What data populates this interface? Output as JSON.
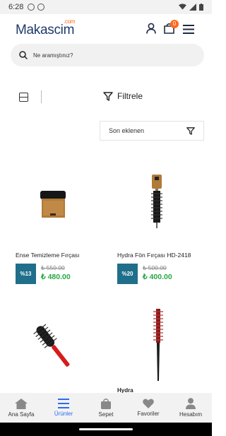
{
  "status_bar": {
    "time": "6:28"
  },
  "header": {
    "logo": "Makascim",
    "logo_suffix": ".com",
    "cart_count": "0"
  },
  "search": {
    "placeholder": "Ne aramıştınız?"
  },
  "toolbar": {
    "filter_label": "Filtrele"
  },
  "sort": {
    "selected": "Son eklenen"
  },
  "products": [
    {
      "name": "Ense Temizleme Fırçası",
      "discount": "%13",
      "old_price": "₺ 550.00",
      "new_price": "₺ 480.00"
    },
    {
      "name": "Hydra Fön Fırçası HD-2418",
      "discount": "%20",
      "old_price": "₺ 500.00",
      "new_price": "₺ 400.00"
    }
  ],
  "partial_product": {
    "name": "Hydra"
  },
  "bottom_nav": [
    {
      "label": "Ana Sayfa",
      "icon": "home-icon"
    },
    {
      "label": "Ürünler",
      "icon": "list-icon",
      "active": true
    },
    {
      "label": "Sepet",
      "icon": "bag-icon"
    },
    {
      "label": "Favoriler",
      "icon": "heart-icon"
    },
    {
      "label": "Hesabım",
      "icon": "person-icon"
    }
  ],
  "colors": {
    "accent": "#2a6cf0",
    "brand": "#1f3a6b",
    "badge": "#ff6a1a",
    "discount_bg": "#1f6f8b",
    "price_green": "#27a844"
  }
}
